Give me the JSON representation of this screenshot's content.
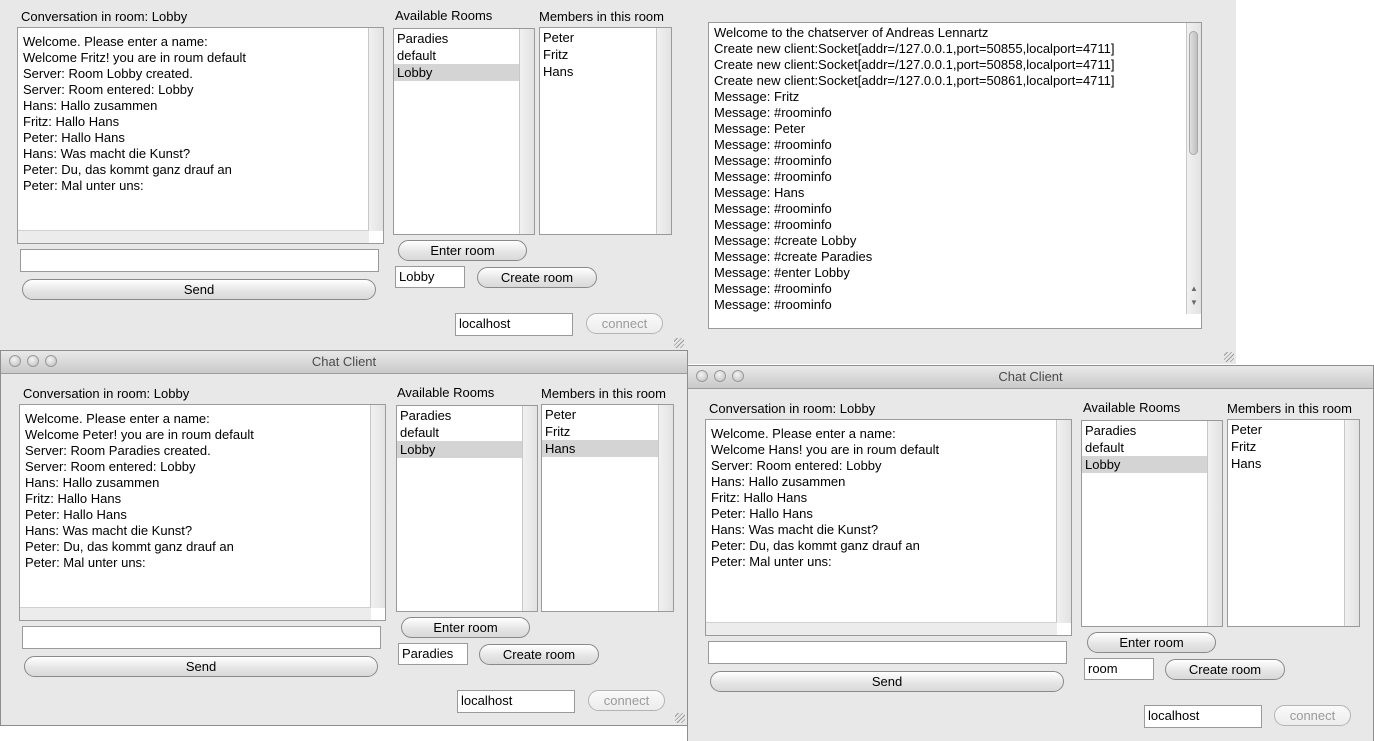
{
  "win1": {
    "conversation_label": "Conversation in room: Lobby",
    "rooms_label": "Available Rooms",
    "members_label": "Members in this room",
    "messages": [
      "Welcome. Please enter a name:",
      "Welcome Fritz! you are in roum default",
      "Server: Room Lobby created.",
      "Server: Room entered: Lobby",
      "Hans: Hallo zusammen",
      "Fritz: Hallo Hans",
      "Peter: Hallo Hans",
      "Hans: Was macht die Kunst?",
      "Peter: Du, das kommt ganz drauf an",
      "Peter: Mal unter uns:"
    ],
    "rooms": [
      "Paradies",
      "default",
      "Lobby"
    ],
    "selected_room": "Lobby",
    "members": [
      "Peter",
      "Fritz",
      "Hans"
    ],
    "selected_member": "",
    "message_input": "",
    "send_label": "Send",
    "enter_room_label": "Enter room",
    "room_name_input": "Lobby",
    "create_room_label": "Create room",
    "host_input": "localhost",
    "connect_label": "connect"
  },
  "server": {
    "log": [
      "Welcome to the chatserver of Andreas Lennartz",
      "Create new client:Socket[addr=/127.0.0.1,port=50855,localport=4711]",
      "Create new client:Socket[addr=/127.0.0.1,port=50858,localport=4711]",
      "Create new client:Socket[addr=/127.0.0.1,port=50861,localport=4711]",
      "Message: Fritz",
      "Message: #roominfo",
      "Message: Peter",
      "Message: #roominfo",
      "Message: #roominfo",
      "Message: #roominfo",
      "Message: Hans",
      "Message: #roominfo",
      "Message: #roominfo",
      "Message: #create Lobby",
      "Message: #create Paradies",
      "Message: #enter Lobby",
      "Message: #roominfo",
      "Message: #roominfo"
    ]
  },
  "win2": {
    "title": "Chat Client",
    "conversation_label": "Conversation in room: Lobby",
    "rooms_label": "Available Rooms",
    "members_label": "Members in this room",
    "messages": [
      "Welcome. Please enter a name:",
      "Welcome Peter! you are in roum default",
      "Server: Room Paradies created.",
      "Server: Room entered: Lobby",
      "Hans: Hallo zusammen",
      "Fritz: Hallo Hans",
      "Peter: Hallo Hans",
      "Hans: Was macht die Kunst?",
      "Peter: Du, das kommt ganz drauf an",
      "Peter: Mal unter uns:"
    ],
    "rooms": [
      "Paradies",
      "default",
      "Lobby"
    ],
    "selected_room": "Lobby",
    "members": [
      "Peter",
      "Fritz",
      "Hans"
    ],
    "selected_member": "Hans",
    "message_input": "",
    "send_label": "Send",
    "enter_room_label": "Enter room",
    "room_name_input": "Paradies",
    "create_room_label": "Create room",
    "host_input": "localhost",
    "connect_label": "connect"
  },
  "win3": {
    "title": "Chat Client",
    "conversation_label": "Conversation in room: Lobby",
    "rooms_label": "Available Rooms",
    "members_label": "Members in this room",
    "messages": [
      "Welcome. Please enter a name:",
      "Welcome Hans! you are in roum default",
      "Server: Room entered: Lobby",
      "Hans: Hallo zusammen",
      "Fritz: Hallo Hans",
      "Peter: Hallo Hans",
      "Hans: Was macht die Kunst?",
      "Peter: Du, das kommt ganz drauf an",
      "Peter: Mal unter uns:"
    ],
    "rooms": [
      "Paradies",
      "default",
      "Lobby"
    ],
    "selected_room": "Lobby",
    "members": [
      "Peter",
      "Fritz",
      "Hans"
    ],
    "selected_member": "",
    "message_input": "",
    "send_label": "Send",
    "enter_room_label": "Enter room",
    "room_name_input": "room",
    "create_room_label": "Create room",
    "host_input": "localhost",
    "connect_label": "connect"
  }
}
